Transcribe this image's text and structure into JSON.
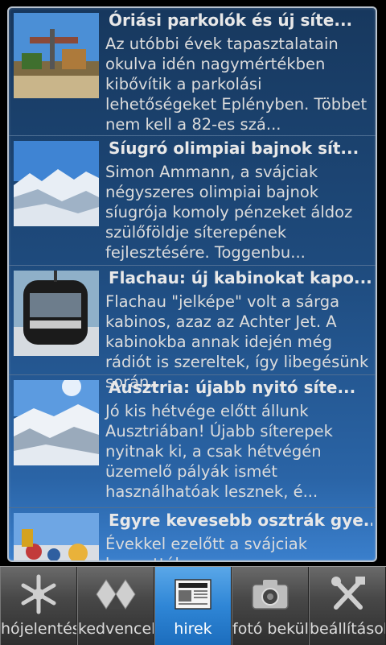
{
  "news": [
    {
      "title": "Óriási parkolók és új síte...",
      "text": "Az utóbbi évek tapasztalatain okulva idén nagymértékben kibővítik a parkolási lehetőségeket Eplényben. Többet nem kell a 82-es szá..."
    },
    {
      "title": "Síugró olimpiai bajnok sít...",
      "text": "Simon Ammann, a svájciak négyszeres olimpiai bajnok síugrója komoly pénzeket áldoz szülőföldje síterepének fejlesztésére. Toggenbu..."
    },
    {
      "title": "Flachau: új kabinokat kapo...",
      "text": "Flachau \"jelképe\" volt a sárga kabinos, azaz az Achter Jet. A kabinokba annak idején még rádiót is szereltek, így libegésünk során..."
    },
    {
      "title": "Ausztria: újabb nyitó síte...",
      "text": "Jó kis hétvége előtt állunk Ausztriában! Újabb síterepek nyitnak ki, a csak hétvégén üzemelő pályák ismét használhatóak lesznek, é..."
    },
    {
      "title": "Egyre kevesebb osztrák gye...",
      "text": "Évekkel ezelőtt a svájciak kongatták"
    }
  ],
  "tabs": [
    {
      "label": "hójelentés",
      "icon": "snowflake-icon"
    },
    {
      "label": "kedvencek",
      "icon": "favorites-icon"
    },
    {
      "label": "hirek",
      "icon": "newspaper-icon",
      "active": true
    },
    {
      "label": "fotó beküldés",
      "icon": "camera-icon"
    },
    {
      "label": "beállítások",
      "icon": "tools-icon"
    }
  ],
  "colors": {
    "active_tab": "#2f86d6",
    "panel": "#1e4a7c"
  }
}
